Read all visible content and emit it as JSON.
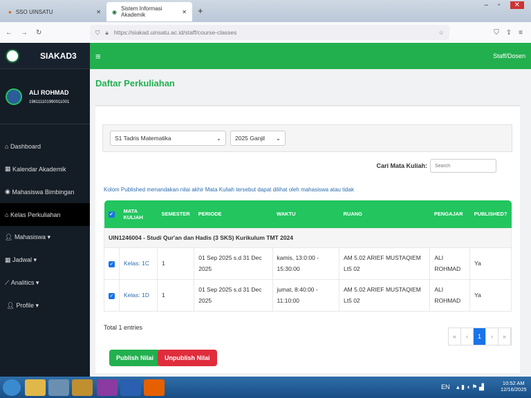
{
  "browser": {
    "tabs": [
      {
        "label": "SSO UINSATU"
      },
      {
        "label": "Sistem Informasi Akademik"
      }
    ],
    "url": "https://siakad.uinsatu.ac.id/staff/course-classes"
  },
  "sidebar": {
    "brand": "SIAKAD3",
    "user_name": "ALI ROHMAD",
    "user_id": "196111101990011001",
    "items": [
      {
        "label": "Dashboard"
      },
      {
        "label": "Kalendar Akademik"
      },
      {
        "label": "Mahasiswa Bimbingan"
      },
      {
        "label": "Kelas Perkuliahan"
      },
      {
        "label": "Mahasiswa ▾"
      },
      {
        "label": "Jadwal ▾"
      },
      {
        "label": "Analitics ▾"
      },
      {
        "label": "Profile ▾"
      }
    ]
  },
  "header": {
    "menu": "≡",
    "role": "Staff/Dosen"
  },
  "page": {
    "title": "Daftar Perkuliahan",
    "program": "S1 Tadris Matematika",
    "semester": "2025 Ganjil",
    "search_label": "Cari Mata Kuliah:",
    "search_placeholder": "Search",
    "note": "Kolom Published menandakan nilai akhir Mata Kuliah tersebut dapat dilihat oleh mahasiswa atau tidak",
    "columns": [
      "MATA KULIAH",
      "SEMESTER",
      "PERIODE",
      "WAKTU",
      "RUANG",
      "PENGAJAR",
      "PUBLISHED?"
    ],
    "group": "UIN1246004 - Studi Qur'an dan Hadis (3 SKS) Kurikulum TMT 2024",
    "rows": [
      {
        "kelas": "Kelas: 1C",
        "semester": "1",
        "periode": "01 Sep 2025 s.d 31 Dec 2025",
        "waktu": "kamis, 13:0:00 - 15:30:00",
        "ruang": "AM 5.02 ARIEF MUSTAQIEM Lt5 02",
        "pengajar": "ALI ROHMAD",
        "published": "Ya"
      },
      {
        "kelas": "Kelas: 1D",
        "semester": "1",
        "periode": "01 Sep 2025 s.d 31 Dec 2025",
        "waktu": "jumat, 8:40:00 - 11:10:00",
        "ruang": "AM 5.02 ARIEF MUSTAQIEM Lt5 02",
        "pengajar": "ALI ROHMAD",
        "published": "Ya"
      }
    ],
    "total": "Total 1 entries",
    "pager": [
      "«",
      "‹",
      "1",
      "›",
      "»"
    ],
    "publish": "Publish Nilai",
    "unpublish": "Unpublish Nilai"
  },
  "taskbar": {
    "lang": "EN",
    "time": "10:52 AM",
    "date": "12/16/2025"
  }
}
